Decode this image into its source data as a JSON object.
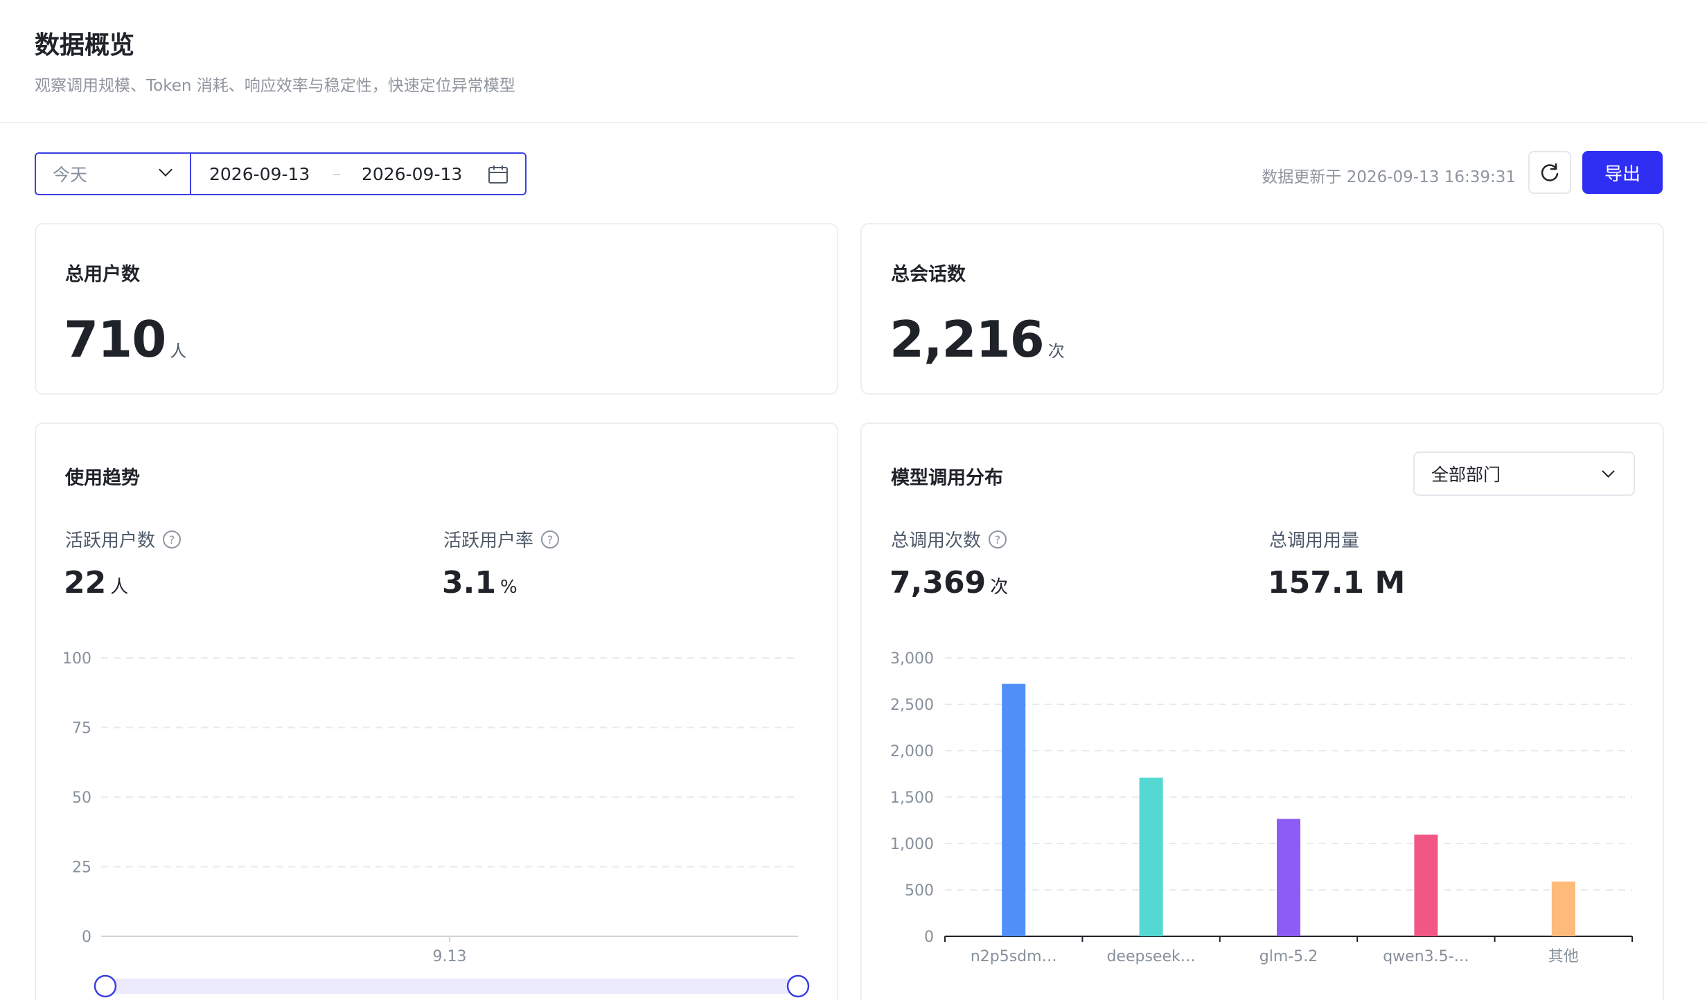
{
  "header": {
    "title": "数据概览",
    "subtitle": "观察调用规模、Token 消耗、响应效率与稳定性，快速定位异常模型"
  },
  "toolbar": {
    "range_value": "今天",
    "start_date": "2026-09-13",
    "date_separator": "–",
    "end_date": "2026-09-13",
    "update_text": "数据更新于 2026-09-13 16:39:31",
    "export_label": "导出",
    "accent_color": "#2f2ff4"
  },
  "stats": {
    "users": {
      "label": "总用户数",
      "value": "710",
      "unit": "人"
    },
    "sessions": {
      "label": "总会话数",
      "value": "2,216",
      "unit": "次"
    }
  },
  "usage_trend": {
    "title": "使用趋势",
    "active_users": {
      "label": "活跃用户数",
      "value": "22",
      "unit": "人"
    },
    "active_rate": {
      "label": "活跃用户率",
      "value": "3.1",
      "unit": "%"
    }
  },
  "model_dist": {
    "title": "模型调用分布",
    "dept_value": "全部部门",
    "total_calls": {
      "label": "总调用次数",
      "value": "7,369",
      "unit": "次"
    },
    "total_usage": {
      "label": "总调用用量",
      "value": "157.1 M"
    }
  },
  "chart_data": [
    {
      "type": "line",
      "x": [
        "9.13"
      ],
      "series": [
        {
          "values": []
        }
      ],
      "yticks": [
        "0",
        "25",
        "50",
        "75",
        "100"
      ],
      "ylim": [
        0,
        100
      ],
      "grid": true,
      "range_slider": {
        "start": 0,
        "end": 1
      }
    },
    {
      "type": "bar",
      "categories": [
        "n2p5sdm…",
        "deepseek…",
        "glm-5.2",
        "qwen3.5-…",
        "其他"
      ],
      "values": [
        2720,
        1710,
        1265,
        1095,
        590
      ],
      "colors": [
        "#4e8ff8",
        "#55d8d2",
        "#8d5cf6",
        "#f05784",
        "#fdbb7a"
      ],
      "yticks": [
        "0",
        "500",
        "1,000",
        "1,500",
        "2,000",
        "2,500",
        "3,000"
      ],
      "ylim": [
        0,
        3000
      ],
      "grid": true
    }
  ]
}
